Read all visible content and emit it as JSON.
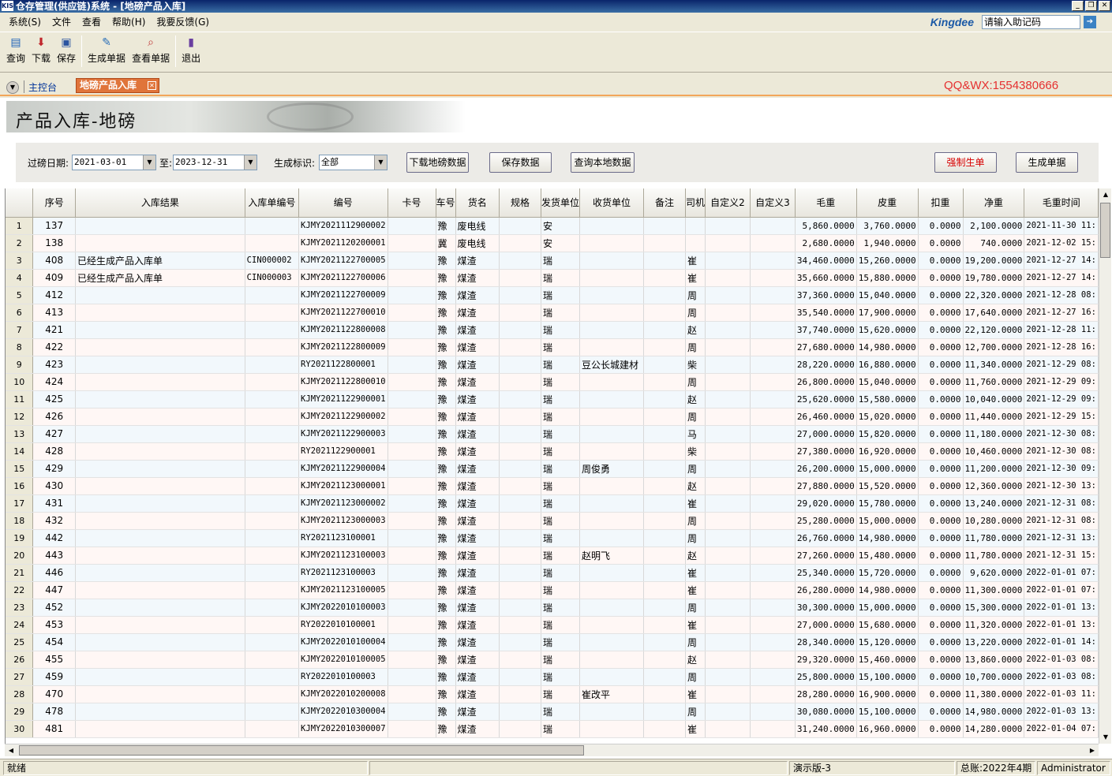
{
  "window": {
    "icon_text": "KIS",
    "title": "仓存管理(供应链)系统 - [地磅产品入库]"
  },
  "menu": [
    "系统(S)",
    "文件",
    "查看",
    "帮助(H)",
    "我要反馈(G)"
  ],
  "helper": {
    "brand": "Kingdee",
    "placeholder": "请输入助记码"
  },
  "toolbar": {
    "query": "查询",
    "download": "下载",
    "save": "保存",
    "generate": "生成单据",
    "view": "查看单据",
    "exit": "退出"
  },
  "tabs": {
    "home": "主控台",
    "active": "地磅产品入库",
    "watermark": "QQ&WX:1554380666"
  },
  "page_title": "产品入库-地磅",
  "filters": {
    "date_label": "过磅日期:",
    "date_from": "2021-03-01",
    "to_label": "至:",
    "date_to": "2023-12-31",
    "flag_label": "生成标识:",
    "flag_value": "全部",
    "btn_download": "下载地磅数据",
    "btn_save": "保存数据",
    "btn_query": "查询本地数据",
    "btn_force": "强制生单",
    "btn_generate": "生成单据"
  },
  "grid": {
    "columns": [
      "序号",
      "入库结果",
      "入库单编号",
      "编号",
      "卡号",
      "车号",
      "货名",
      "规格",
      "发货单位",
      "收货单位",
      "备注",
      "司机",
      "自定义2",
      "自定义3",
      "毛重",
      "皮重",
      "扣重",
      "净重",
      "毛重时间"
    ],
    "rows": [
      [
        "1",
        "137",
        "",
        "",
        "KJMY2021112900002",
        "",
        "豫",
        "废电线",
        "",
        "安",
        "",
        "",
        "",
        "",
        "",
        "5,860.0000",
        "3,760.0000",
        "0.0000",
        "2,100.0000",
        "2021-11-30 11:"
      ],
      [
        "2",
        "138",
        "",
        "",
        "KJMY2021120200001",
        "",
        "冀",
        "废电线",
        "",
        "安",
        "",
        "",
        "",
        "",
        "",
        "2,680.0000",
        "1,940.0000",
        "0.0000",
        "740.0000",
        "2021-12-02 15:"
      ],
      [
        "3",
        "408",
        "已经生成产品入库单",
        "CIN000002",
        "KJMY2021122700005",
        "",
        "豫",
        "煤渣",
        "",
        "瑞",
        "",
        "",
        "崔",
        "",
        "",
        "34,460.0000",
        "15,260.0000",
        "0.0000",
        "19,200.0000",
        "2021-12-27 14:"
      ],
      [
        "4",
        "409",
        "已经生成产品入库单",
        "CIN000003",
        "KJMY2021122700006",
        "",
        "豫",
        "煤渣",
        "",
        "瑞",
        "",
        "",
        "崔",
        "",
        "",
        "35,660.0000",
        "15,880.0000",
        "0.0000",
        "19,780.0000",
        "2021-12-27 14:"
      ],
      [
        "5",
        "412",
        "",
        "",
        "KJMY2021122700009",
        "",
        "豫",
        "煤渣",
        "",
        "瑞",
        "",
        "",
        "周",
        "",
        "",
        "37,360.0000",
        "15,040.0000",
        "0.0000",
        "22,320.0000",
        "2021-12-28 08:"
      ],
      [
        "6",
        "413",
        "",
        "",
        "KJMY2021122700010",
        "",
        "豫",
        "煤渣",
        "",
        "瑞",
        "",
        "",
        "周",
        "",
        "",
        "35,540.0000",
        "17,900.0000",
        "0.0000",
        "17,640.0000",
        "2021-12-27 16:"
      ],
      [
        "7",
        "421",
        "",
        "",
        "KJMY2021122800008",
        "",
        "豫",
        "煤渣",
        "",
        "瑞",
        "",
        "",
        "赵",
        "",
        "",
        "37,740.0000",
        "15,620.0000",
        "0.0000",
        "22,120.0000",
        "2021-12-28 11:"
      ],
      [
        "8",
        "422",
        "",
        "",
        "KJMY2021122800009",
        "",
        "豫",
        "煤渣",
        "",
        "瑞",
        "",
        "",
        "周",
        "",
        "",
        "27,680.0000",
        "14,980.0000",
        "0.0000",
        "12,700.0000",
        "2021-12-28 16:"
      ],
      [
        "9",
        "423",
        "",
        "",
        "RY2021122800001",
        "",
        "豫",
        "煤渣",
        "",
        "瑞",
        "豆公长城建材",
        "",
        "柴",
        "",
        "",
        "28,220.0000",
        "16,880.0000",
        "0.0000",
        "11,340.0000",
        "2021-12-29 08:"
      ],
      [
        "10",
        "424",
        "",
        "",
        "KJMY2021122800010",
        "",
        "豫",
        "煤渣",
        "",
        "瑞",
        "",
        "",
        "周",
        "",
        "",
        "26,800.0000",
        "15,040.0000",
        "0.0000",
        "11,760.0000",
        "2021-12-29 09:"
      ],
      [
        "11",
        "425",
        "",
        "",
        "KJMY2021122900001",
        "",
        "豫",
        "煤渣",
        "",
        "瑞",
        "",
        "",
        "赵",
        "",
        "",
        "25,620.0000",
        "15,580.0000",
        "0.0000",
        "10,040.0000",
        "2021-12-29 09:"
      ],
      [
        "12",
        "426",
        "",
        "",
        "KJMY2021122900002",
        "",
        "豫",
        "煤渣",
        "",
        "瑞",
        "",
        "",
        "周",
        "",
        "",
        "26,460.0000",
        "15,020.0000",
        "0.0000",
        "11,440.0000",
        "2021-12-29 15:"
      ],
      [
        "13",
        "427",
        "",
        "",
        "KJMY2021122900003",
        "",
        "豫",
        "煤渣",
        "",
        "瑞",
        "",
        "",
        "马",
        "",
        "",
        "27,000.0000",
        "15,820.0000",
        "0.0000",
        "11,180.0000",
        "2021-12-30 08:"
      ],
      [
        "14",
        "428",
        "",
        "",
        "RY2021122900001",
        "",
        "豫",
        "煤渣",
        "",
        "瑞",
        "",
        "",
        "柴",
        "",
        "",
        "27,380.0000",
        "16,920.0000",
        "0.0000",
        "10,460.0000",
        "2021-12-30 08:"
      ],
      [
        "15",
        "429",
        "",
        "",
        "KJMY2021122900004",
        "",
        "豫",
        "煤渣",
        "",
        "瑞",
        "周俊勇",
        "",
        "周",
        "",
        "",
        "26,200.0000",
        "15,000.0000",
        "0.0000",
        "11,200.0000",
        "2021-12-30 09:"
      ],
      [
        "16",
        "430",
        "",
        "",
        "KJMY2021123000001",
        "",
        "豫",
        "煤渣",
        "",
        "瑞",
        "",
        "",
        "赵",
        "",
        "",
        "27,880.0000",
        "15,520.0000",
        "0.0000",
        "12,360.0000",
        "2021-12-30 13:"
      ],
      [
        "17",
        "431",
        "",
        "",
        "KJMY2021123000002",
        "",
        "豫",
        "煤渣",
        "",
        "瑞",
        "",
        "",
        "崔",
        "",
        "",
        "29,020.0000",
        "15,780.0000",
        "0.0000",
        "13,240.0000",
        "2021-12-31 08:"
      ],
      [
        "18",
        "432",
        "",
        "",
        "KJMY2021123000003",
        "",
        "豫",
        "煤渣",
        "",
        "瑞",
        "",
        "",
        "周",
        "",
        "",
        "25,280.0000",
        "15,000.0000",
        "0.0000",
        "10,280.0000",
        "2021-12-31 08:"
      ],
      [
        "19",
        "442",
        "",
        "",
        "RY2021123100001",
        "",
        "豫",
        "煤渣",
        "",
        "瑞",
        "",
        "",
        "周",
        "",
        "",
        "26,760.0000",
        "14,980.0000",
        "0.0000",
        "11,780.0000",
        "2021-12-31 13:"
      ],
      [
        "20",
        "443",
        "",
        "",
        "KJMY2021123100003",
        "",
        "豫",
        "煤渣",
        "",
        "瑞",
        "赵明飞",
        "",
        "赵",
        "",
        "",
        "27,260.0000",
        "15,480.0000",
        "0.0000",
        "11,780.0000",
        "2021-12-31 15:"
      ],
      [
        "21",
        "446",
        "",
        "",
        "RY2021123100003",
        "",
        "豫",
        "煤渣",
        "",
        "瑞",
        "",
        "",
        "崔",
        "",
        "",
        "25,340.0000",
        "15,720.0000",
        "0.0000",
        "9,620.0000",
        "2022-01-01 07:"
      ],
      [
        "22",
        "447",
        "",
        "",
        "KJMY2021123100005",
        "",
        "豫",
        "煤渣",
        "",
        "瑞",
        "",
        "",
        "崔",
        "",
        "",
        "26,280.0000",
        "14,980.0000",
        "0.0000",
        "11,300.0000",
        "2022-01-01 07:"
      ],
      [
        "23",
        "452",
        "",
        "",
        "KJMY2022010100003",
        "",
        "豫",
        "煤渣",
        "",
        "瑞",
        "",
        "",
        "周",
        "",
        "",
        "30,300.0000",
        "15,000.0000",
        "0.0000",
        "15,300.0000",
        "2022-01-01 13:"
      ],
      [
        "24",
        "453",
        "",
        "",
        "RY2022010100001",
        "",
        "豫",
        "煤渣",
        "",
        "瑞",
        "",
        "",
        "崔",
        "",
        "",
        "27,000.0000",
        "15,680.0000",
        "0.0000",
        "11,320.0000",
        "2022-01-01 13:"
      ],
      [
        "25",
        "454",
        "",
        "",
        "KJMY2022010100004",
        "",
        "豫",
        "煤渣",
        "",
        "瑞",
        "",
        "",
        "周",
        "",
        "",
        "28,340.0000",
        "15,120.0000",
        "0.0000",
        "13,220.0000",
        "2022-01-01 14:"
      ],
      [
        "26",
        "455",
        "",
        "",
        "KJMY2022010100005",
        "",
        "豫",
        "煤渣",
        "",
        "瑞",
        "",
        "",
        "赵",
        "",
        "",
        "29,320.0000",
        "15,460.0000",
        "0.0000",
        "13,860.0000",
        "2022-01-03 08:"
      ],
      [
        "27",
        "459",
        "",
        "",
        "RY2022010100003",
        "",
        "豫",
        "煤渣",
        "",
        "瑞",
        "",
        "",
        "周",
        "",
        "",
        "25,800.0000",
        "15,100.0000",
        "0.0000",
        "10,700.0000",
        "2022-01-03 08:"
      ],
      [
        "28",
        "470",
        "",
        "",
        "KJMY2022010200008",
        "",
        "豫",
        "煤渣",
        "",
        "瑞",
        "崔改平",
        "",
        "崔",
        "",
        "",
        "28,280.0000",
        "16,900.0000",
        "0.0000",
        "11,380.0000",
        "2022-01-03 11:"
      ],
      [
        "29",
        "478",
        "",
        "",
        "KJMY2022010300004",
        "",
        "豫",
        "煤渣",
        "",
        "瑞",
        "",
        "",
        "周",
        "",
        "",
        "30,080.0000",
        "15,100.0000",
        "0.0000",
        "14,980.0000",
        "2022-01-03 13:"
      ],
      [
        "30",
        "481",
        "",
        "",
        "KJMY2022010300007",
        "",
        "豫",
        "煤渣",
        "",
        "瑞",
        "",
        "",
        "崔",
        "",
        "",
        "31,240.0000",
        "16,960.0000",
        "0.0000",
        "14,280.0000",
        "2022-01-04 07:"
      ]
    ]
  },
  "status": {
    "ready": "就绪",
    "edition": "演示版-3",
    "ledger": "总账:2022年4期",
    "user": "Administrator"
  }
}
